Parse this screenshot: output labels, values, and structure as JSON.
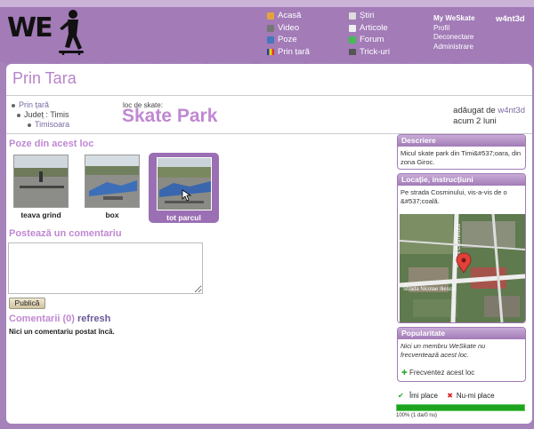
{
  "header": {
    "logo_text": "WE",
    "nav_left": [
      {
        "label": "Acasă",
        "icon": "home-icon",
        "color": "#e4a23c"
      },
      {
        "label": "Video",
        "icon": "film-icon",
        "color": "#777777"
      },
      {
        "label": "Poze",
        "icon": "photo-icon",
        "color": "#4477bb"
      },
      {
        "label": "Prin țară",
        "icon": "flag-icon",
        "color": "#d33b2c"
      }
    ],
    "nav_right": [
      {
        "label": "Știri",
        "icon": "newspaper-icon",
        "color": "#dddddd"
      },
      {
        "label": "Articole",
        "icon": "document-icon",
        "color": "#eeeeee"
      },
      {
        "label": "Forum",
        "icon": "forum-icon",
        "color": "#44bb55"
      },
      {
        "label": "Trick-uri",
        "icon": "skateboard-icon",
        "color": "#555555"
      }
    ],
    "user_menu": [
      "My WeSkate",
      "Profil",
      "Deconectare",
      "Administrare"
    ],
    "username": "w4nt3d"
  },
  "page": {
    "title": "Prin Tara",
    "breadcrumb": [
      "Prin țară",
      "Județ : Timis",
      "Timisoara"
    ],
    "spot_label": "loc de skate:",
    "spot_name": "Skate Park",
    "added_prefix": "adăugat de",
    "added_user": "w4nt3d",
    "added_time": "acum 2 luni"
  },
  "photos": {
    "heading": "Poze din acest loc",
    "items": [
      {
        "caption": "teava grind",
        "selected": false
      },
      {
        "caption": "box",
        "selected": false
      },
      {
        "caption": "tot parcul",
        "selected": true
      }
    ]
  },
  "comment_form": {
    "heading": "Postează un comentariu",
    "value": "",
    "submit_label": "Publică"
  },
  "comments": {
    "heading": "Comentarii (0)",
    "refresh_label": "refresh",
    "empty_text": "Nici un comentariu postat încă."
  },
  "sidebar": {
    "description": {
      "title": "Descriere",
      "text": "Micul skate park din Timi&#537;oara, din zona Giroc."
    },
    "location": {
      "title": "Locație, instrucțiuni",
      "text": "Pe strada Cosminului, vis-a-vis de o &#537;coală.",
      "map_labels": [
        "Strada Nicolae Iliescu",
        "Strada Cosminului"
      ]
    },
    "popularity": {
      "title": "Popularitate",
      "text": "Nici un membru WeSkate nu frecventează acest loc.",
      "frequent_label": "Frecventez acest loc",
      "like_label": "Îmi place",
      "dislike_label": "Nu-mi place",
      "score_text": "100% (1 da/0 nu)",
      "score_fraction": 1.0
    }
  }
}
